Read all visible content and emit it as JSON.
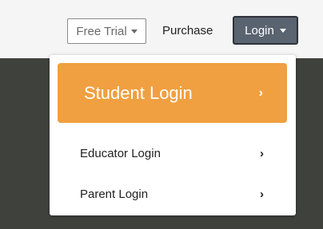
{
  "header": {
    "free_trial_label": "Free Trial",
    "purchase_label": "Purchase",
    "login_label": "Login"
  },
  "menu": {
    "student_label": "Student Login",
    "educator_label": "Educator Login",
    "parent_label": "Parent Login",
    "chevron": "›"
  },
  "colors": {
    "accent": "#f0a040",
    "login_button": "#5a6370",
    "backdrop": "#3f413d"
  }
}
